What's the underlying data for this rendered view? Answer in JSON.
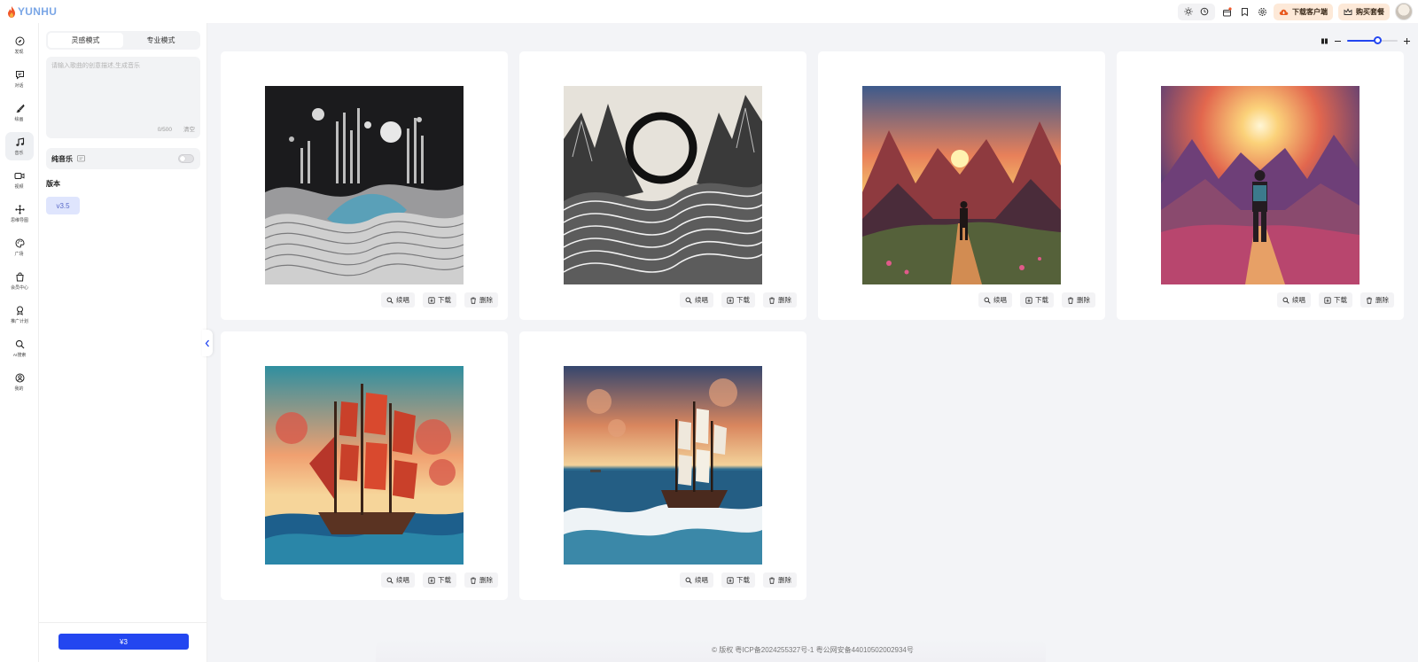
{
  "app": {
    "logo_text": "YUNHU"
  },
  "topbar": {
    "download_client_label": "下载客户端",
    "buy_plan_label": "购买套餐"
  },
  "rail": {
    "items": [
      {
        "label": "发现",
        "icon": "compass-icon"
      },
      {
        "label": "对话",
        "icon": "chat-icon"
      },
      {
        "label": "绘画",
        "icon": "brush-icon"
      },
      {
        "label": "音乐",
        "icon": "music-icon",
        "active": true
      },
      {
        "label": "视频",
        "icon": "video-icon"
      },
      {
        "label": "思维导图",
        "icon": "mindmap-icon"
      },
      {
        "label": "广场",
        "icon": "palette-icon"
      },
      {
        "label": "会员中心",
        "icon": "bag-icon"
      },
      {
        "label": "推广计划",
        "icon": "medal-icon"
      },
      {
        "label": "AI搜索",
        "icon": "search-icon"
      },
      {
        "label": "我的",
        "icon": "user-icon"
      }
    ]
  },
  "panel": {
    "mode_tabs": [
      "灵感模式",
      "专业模式"
    ],
    "active_mode": 0,
    "prompt": {
      "placeholder": "请输入歌曲的创意描述,生成音乐",
      "value": "",
      "counter": "0/500",
      "clear_label": "清空"
    },
    "pure_music": {
      "label": "纯音乐",
      "enabled": false
    },
    "version_label": "版本",
    "version_value": "v3.5",
    "submit_label": "¥3"
  },
  "zoom": {
    "level": 0.6
  },
  "cards": [
    {
      "art": "wave-abstract",
      "actions": [
        "续唱",
        "下载",
        "删除"
      ]
    },
    {
      "art": "ring-mountains",
      "actions": [
        "续唱",
        "下载",
        "删除"
      ]
    },
    {
      "art": "sunset-valley-hiker",
      "actions": [
        "续唱",
        "下载",
        "删除"
      ]
    },
    {
      "art": "sun-mountains-hiker",
      "actions": [
        "续唱",
        "下载",
        "删除"
      ]
    },
    {
      "art": "red-sail-ship",
      "actions": [
        "续唱",
        "下载",
        "删除"
      ]
    },
    {
      "art": "ship-waves",
      "actions": [
        "续唱",
        "下载",
        "删除"
      ]
    }
  ],
  "footer": {
    "text": "© 版权 粤ICP备2024255327号-1 粤公网安备44010502002934号"
  },
  "colors": {
    "accent": "#2346f0",
    "orange": "#fde9d8",
    "background": "#f3f4f7"
  }
}
